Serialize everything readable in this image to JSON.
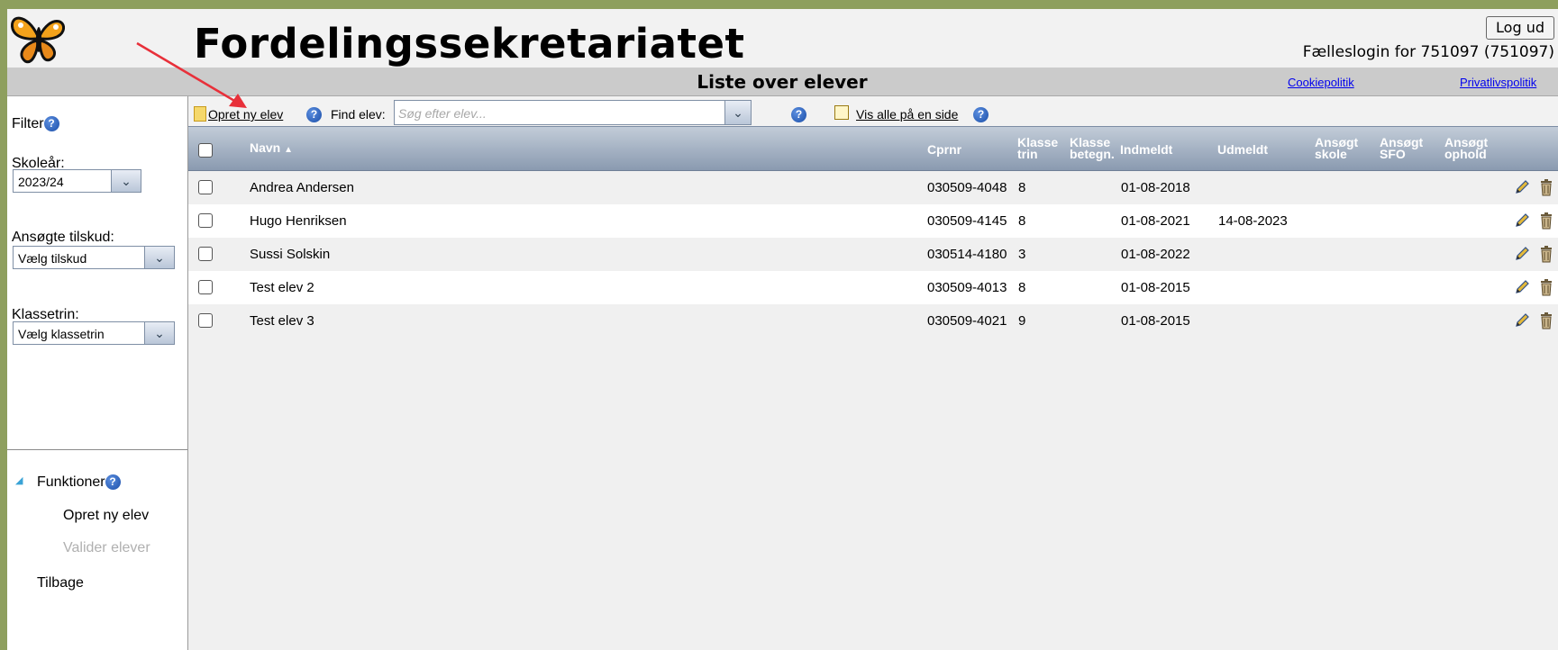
{
  "header": {
    "title": "Fordelingssekretariatet",
    "logout_label": "Log ud",
    "login_info": "Fælleslogin for 751097 (751097)"
  },
  "band": {
    "page_title": "Liste over elever",
    "cookie_link": "Cookiepolitik",
    "privacy_link": "Privatlivspolitik"
  },
  "sidebar": {
    "filter_label": "Filter",
    "school_year_label": "Skoleår:",
    "school_year_value": "2023/24",
    "grants_label": "Ansøgte tilskud:",
    "grants_value": "Vælg tilskud",
    "grade_label": "Klassetrin:",
    "grade_value": "Vælg klassetrin",
    "functions_label": "Funktioner",
    "functions": [
      "Opret ny elev",
      "Valider elever"
    ],
    "back_label": "Tilbage"
  },
  "toolbar": {
    "create_label": "Opret ny elev",
    "find_label": "Find elev:",
    "search_placeholder": "Søg efter elev...",
    "show_all_label": "Vis alle på en side"
  },
  "table": {
    "headers": {
      "navn": "Navn",
      "cprnr": "Cprnr",
      "klasse_trin": [
        "Klasse",
        "trin"
      ],
      "klasse_betegn": [
        "Klasse",
        "betegn."
      ],
      "indmeldt": "Indmeldt",
      "udmeldt": "Udmeldt",
      "ans_skole": [
        "Ansøgt",
        "skole"
      ],
      "ans_sfo": [
        "Ansøgt",
        "SFO"
      ],
      "ans_ophold": [
        "Ansøgt",
        "ophold"
      ]
    },
    "rows": [
      {
        "navn": "Andrea Andersen",
        "cprnr": "030509-4048",
        "trin": "8",
        "indmeldt": "01-08-2018",
        "udmeldt": ""
      },
      {
        "navn": "Hugo Henriksen",
        "cprnr": "030509-4145",
        "trin": "8",
        "indmeldt": "01-08-2021",
        "udmeldt": "14-08-2023"
      },
      {
        "navn": "Sussi Solskin",
        "cprnr": "030514-4180",
        "trin": "3",
        "indmeldt": "01-08-2022",
        "udmeldt": ""
      },
      {
        "navn": "Test elev 2",
        "cprnr": "030509-4013",
        "trin": "8",
        "indmeldt": "01-08-2015",
        "udmeldt": ""
      },
      {
        "navn": "Test elev 3",
        "cprnr": "030509-4021",
        "trin": "9",
        "indmeldt": "01-08-2015",
        "udmeldt": ""
      }
    ]
  },
  "icons": {
    "logo": "butterfly-logo",
    "help": "help-icon",
    "sort": "sort-ascending-icon",
    "edit": "pencil-icon",
    "delete": "trash-icon"
  },
  "colors": {
    "frame_border": "#8e9f5e",
    "table_header": "#8a9ab0",
    "annotation_arrow": "#e8303a"
  }
}
